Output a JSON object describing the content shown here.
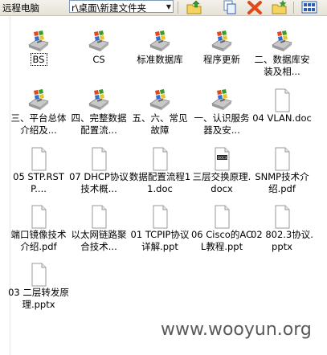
{
  "toolbar": {
    "location_label": "远程电脑",
    "address_value": "r\\桌面\\新建文件夹",
    "icons": [
      "folder-up-icon",
      "copy-icon",
      "delete-icon",
      "new-folder-icon",
      "view-icon"
    ]
  },
  "files": [
    {
      "label": "BS",
      "type": "app",
      "selected": true
    },
    {
      "label": "CS",
      "type": "app"
    },
    {
      "label": "标准数据库",
      "type": "app"
    },
    {
      "label": "程序更新",
      "type": "app"
    },
    {
      "label": "二、数据库安装及相...",
      "type": "app"
    },
    {
      "label": "三、平台总体介绍及...",
      "type": "app"
    },
    {
      "label": "四、完整数据配置流...",
      "type": "app"
    },
    {
      "label": "五、六、常见故障",
      "type": "app"
    },
    {
      "label": "一、认识服务器及安...",
      "type": "app"
    },
    {
      "label": "04 VLAN.doc",
      "type": "doc"
    },
    {
      "label": "05 STP.RSTP....",
      "type": "doc"
    },
    {
      "label": "07 DHCP协议技术概...",
      "type": "doc"
    },
    {
      "label": "数据配置流程11.doc",
      "type": "doc"
    },
    {
      "label": "三层交换原理.docx",
      "type": "docx"
    },
    {
      "label": "SNMP技术介绍.pdf",
      "type": "doc"
    },
    {
      "label": "端口镜像技术介绍.pdf",
      "type": "doc"
    },
    {
      "label": "以太网链路聚合技术...",
      "type": "doc"
    },
    {
      "label": "01 TCPIP协议详解.ppt",
      "type": "doc"
    },
    {
      "label": "06 Cisco的ACL教程.ppt",
      "type": "doc"
    },
    {
      "label": "02 802.3协议.pptx",
      "type": "doc"
    },
    {
      "label": "03 二层转发原理.pptx",
      "type": "doc"
    }
  ],
  "docx_badge": "DOCX",
  "watermark": "www.wooyun.org",
  "colors": {
    "toolbar_bg": "#ece9d8",
    "icon_blue": "#2f5fb3",
    "icon_green": "#3a9a2a",
    "accent_yellow": "#e8c62a",
    "delete_red": "#e04a1a"
  }
}
